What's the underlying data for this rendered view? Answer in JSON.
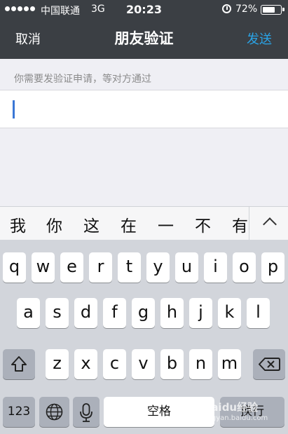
{
  "status_bar": {
    "carrier": "中国联通",
    "network": "3G",
    "time": "20:23",
    "battery_percent": "72%",
    "battery_level": 0.72,
    "signal_dots": 5,
    "alarm_icon": "alarm-clock-icon"
  },
  "nav": {
    "cancel_label": "取消",
    "title": "朋友验证",
    "send_label": "发送",
    "send_color": "#2aa3e6"
  },
  "form": {
    "hint": "你需要发验证申请，等对方通过",
    "input_value": ""
  },
  "candidates": [
    "我",
    "你",
    "这",
    "在",
    "一",
    "不",
    "有"
  ],
  "keyboard": {
    "row1": [
      "q",
      "w",
      "e",
      "r",
      "t",
      "y",
      "u",
      "i",
      "o",
      "p"
    ],
    "row2": [
      "a",
      "s",
      "d",
      "f",
      "g",
      "h",
      "j",
      "k",
      "l"
    ],
    "row3": [
      "z",
      "x",
      "c",
      "v",
      "b",
      "n",
      "m"
    ],
    "numbers_label": "123",
    "space_label": "空格",
    "return_label": "换行",
    "shift_icon": "shift-icon",
    "delete_icon": "backspace-icon",
    "globe_icon": "globe-icon",
    "mic_icon": "microphone-icon"
  },
  "watermark": {
    "text": "Baidu经验",
    "sub": "jingyan.baidu.com"
  }
}
